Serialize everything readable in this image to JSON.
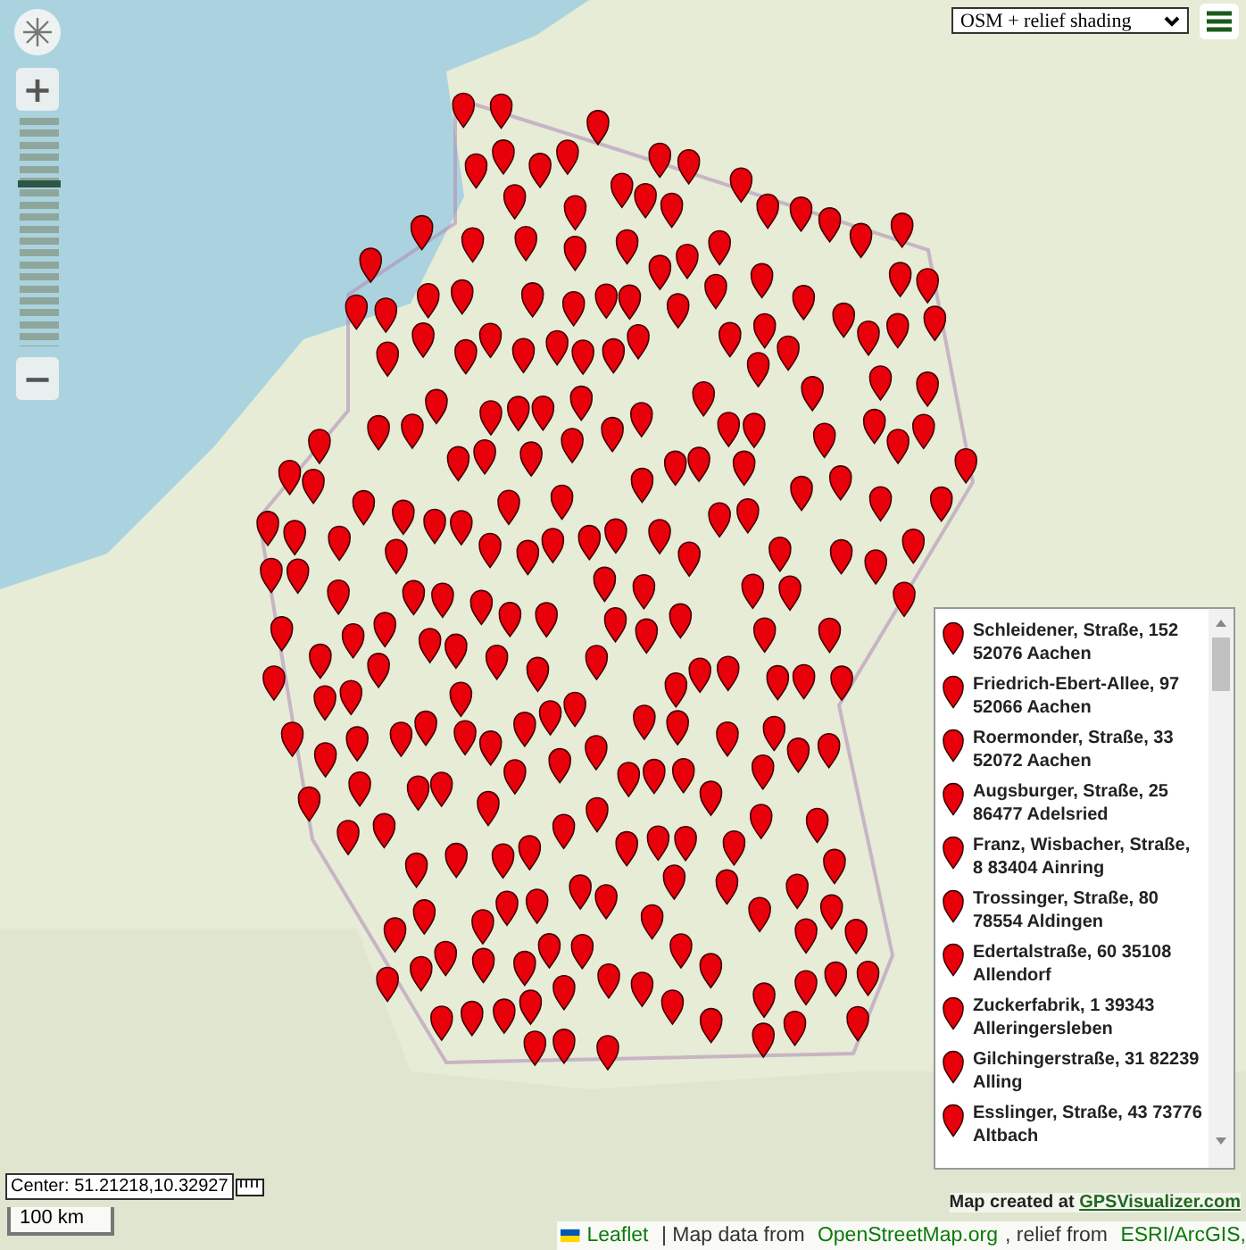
{
  "map_style_select": {
    "value": "OSM + relief shading"
  },
  "zoom": {
    "in_label": "+",
    "out_label": "−",
    "level": 0.72
  },
  "locations": [
    {
      "street": "Schleidener, Straße, 152",
      "place": "52076 Aachen"
    },
    {
      "street": "Friedrich-Ebert-Allee, 97",
      "place": "52066 Aachen"
    },
    {
      "street": "Roermonder, Straße, 33",
      "place": "52072 Aachen"
    },
    {
      "street": "Augsburger, Straße, 25",
      "place": "86477 Adelsried"
    },
    {
      "street": "Franz, Wisbacher, Straße,",
      "place": "8 83404 Ainring"
    },
    {
      "street": "Trossinger, Straße, 80",
      "place": "78554 Aldingen"
    },
    {
      "street": "Edertalstraße, 60 35108",
      "place": "Allendorf"
    },
    {
      "street": "Zuckerfabrik, 1 39343",
      "place": "Alleringersleben"
    },
    {
      "street": "Gilchingerstraße, 31 82239",
      "place": "Alling"
    },
    {
      "street": "Esslinger, Straße, 43 73776",
      "place": "Altbach"
    }
  ],
  "center": "Center: 51.21218,10.32927",
  "scale": "100 km",
  "credit": {
    "text": "Map created at",
    "link": "GPSVisualizer.com"
  },
  "attribution": [
    {
      "kind": "link",
      "text": "Leaflet"
    },
    {
      "kind": "text",
      "text": " | Map data from "
    },
    {
      "kind": "link",
      "text": "OpenStreetMap.org"
    },
    {
      "kind": "text",
      "text": ", relief from "
    },
    {
      "kind": "link",
      "text": "ESRI/ArcGIS,"
    }
  ]
}
